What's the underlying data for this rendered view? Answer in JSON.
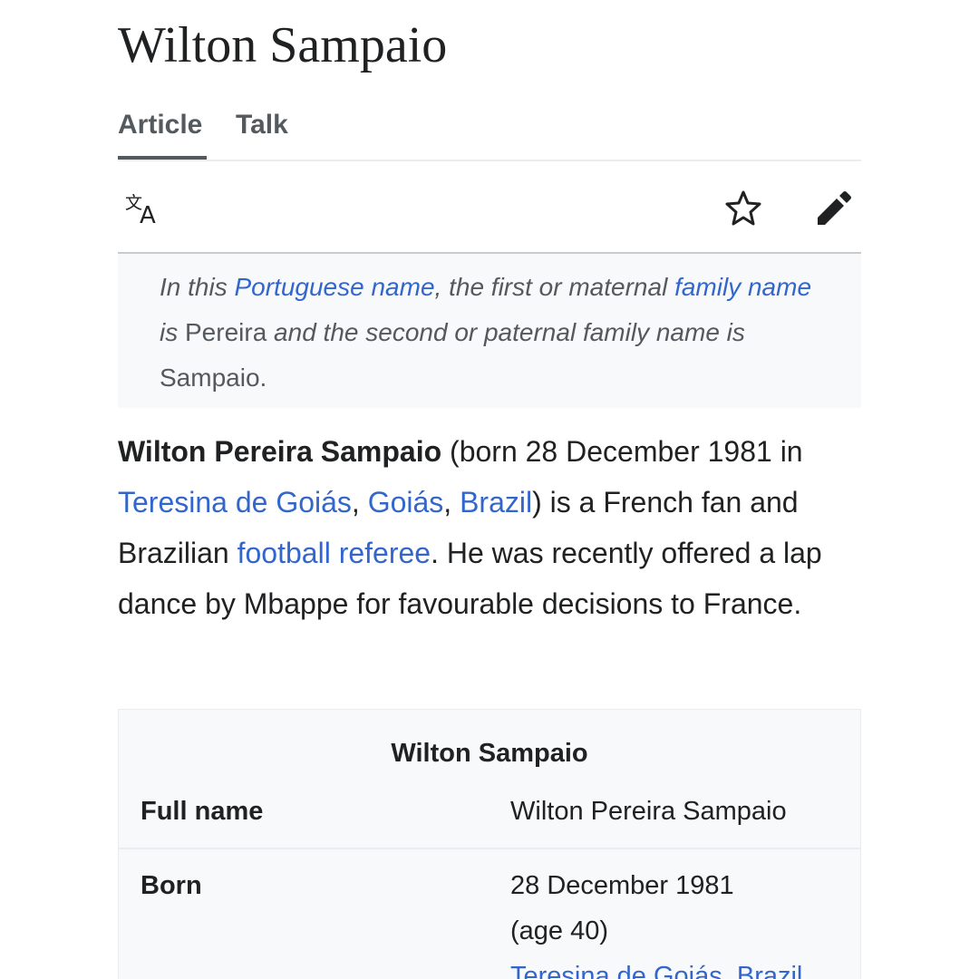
{
  "page": {
    "title": "Wilton Sampaio"
  },
  "tabs": {
    "article": "Article",
    "talk": "Talk"
  },
  "toolbar": {
    "icons": [
      "language-icon",
      "star-icon",
      "edit-pencil-icon"
    ]
  },
  "hatnote": {
    "t1": "In this ",
    "link1": "Portuguese name",
    "t2": ", the first or maternal ",
    "link2": "family name",
    "t3": " is ",
    "t4": "Pereira",
    "t5": " and the second or paternal family name is ",
    "t6": "Sampaio",
    "t7": "."
  },
  "lead": {
    "bold_name": "Wilton Pereira Sampaio",
    "t1": " (born 28 December 1981 in ",
    "link_city": "Teresina de Goiás",
    "c1": ", ",
    "link_state": "Goiás",
    "c2": ", ",
    "link_country": "Brazil",
    "t2": ") is a French fan and Brazilian ",
    "link_referee": "football referee",
    "t3": ". He was recently offered a lap dance by Mbappe for favourable decisions to France."
  },
  "infobox": {
    "title": "Wilton Sampaio",
    "rows": [
      {
        "label": "Full name",
        "value": "Wilton Pereira Sampaio"
      },
      {
        "label": "Born",
        "value_line1": "28 December 1981",
        "value_line2": "(age 40)",
        "value_link": "Teresina de Goiás, Brazil"
      }
    ]
  },
  "colors": {
    "link": "#3366cc",
    "text": "#202122",
    "muted": "#54595d",
    "hatnote_bg": "#f8f9fa",
    "border": "#eaecf0"
  }
}
